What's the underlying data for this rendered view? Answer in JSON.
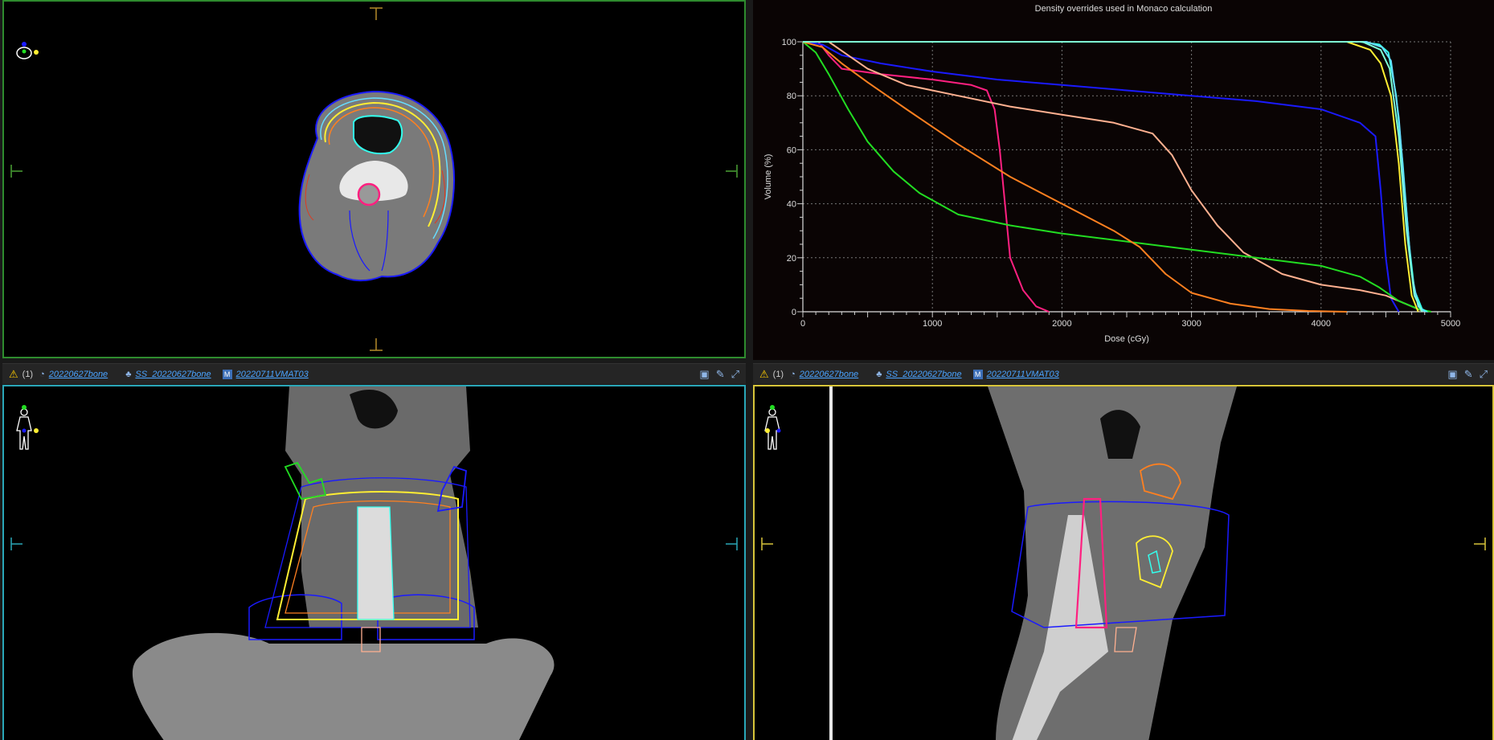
{
  "toolbar_left": {
    "warning_count": "(1)",
    "image_set": "20220627bone",
    "structure_set": "SS_20220627bone",
    "plan": "20220711VMAT03"
  },
  "toolbar_right": {
    "warning_count": "(1)",
    "image_set": "20220627bone",
    "structure_set": "SS_20220627bone",
    "plan": "20220711VMAT03"
  },
  "dvh": {
    "title": "Density overrides used in Monaco calculation"
  },
  "chart_data": {
    "type": "line",
    "title": "Density overrides used in Monaco calculation",
    "xlabel": "Dose (cGy)",
    "ylabel": "Volume (%)",
    "xlim": [
      0,
      5000
    ],
    "ylim": [
      0,
      100
    ],
    "xticks": [
      "0",
      "1000",
      "2000",
      "3000",
      "4000",
      "5000"
    ],
    "yticks": [
      "0",
      "20",
      "40",
      "60",
      "80",
      "100"
    ],
    "grid": true,
    "series": [
      {
        "color": "#ff2080",
        "x": [
          0,
          120,
          200,
          300,
          600,
          1000,
          1300,
          1420,
          1480,
          1520,
          1560,
          1600,
          1700,
          1800,
          1900
        ],
        "y": [
          100,
          100,
          95,
          90,
          88,
          86,
          84,
          82,
          75,
          60,
          40,
          20,
          8,
          2,
          0
        ]
      },
      {
        "color": "#1a1aff",
        "x": [
          0,
          150,
          300,
          600,
          1000,
          1500,
          2000,
          2500,
          3000,
          3500,
          4000,
          4300,
          4420,
          4460,
          4500,
          4540,
          4600
        ],
        "y": [
          100,
          99,
          95,
          92,
          89,
          86,
          84,
          82,
          80,
          78,
          75,
          70,
          65,
          45,
          20,
          5,
          0
        ]
      },
      {
        "color": "#ffb090",
        "x": [
          0,
          200,
          350,
          500,
          800,
          1200,
          1600,
          2000,
          2400,
          2700,
          2850,
          3000,
          3200,
          3400,
          3700,
          4000,
          4300,
          4500,
          4700,
          4800
        ],
        "y": [
          100,
          100,
          95,
          90,
          84,
          80,
          76,
          73,
          70,
          66,
          58,
          45,
          32,
          22,
          14,
          10,
          8,
          6,
          2,
          0
        ]
      },
      {
        "color": "#22dd22",
        "x": [
          0,
          100,
          200,
          350,
          500,
          700,
          900,
          1200,
          1600,
          2000,
          2500,
          3000,
          3500,
          4000,
          4300,
          4450,
          4600,
          4750,
          4850
        ],
        "y": [
          100,
          96,
          88,
          75,
          63,
          52,
          44,
          36,
          32,
          29,
          26,
          23,
          20,
          17,
          13,
          9,
          4,
          1,
          0
        ]
      },
      {
        "color": "#ff8020",
        "x": [
          0,
          150,
          300,
          500,
          800,
          1200,
          1600,
          2000,
          2400,
          2600,
          2800,
          3000,
          3300,
          3600,
          3900,
          4200
        ],
        "y": [
          100,
          98,
          92,
          85,
          75,
          62,
          50,
          40,
          30,
          24,
          14,
          7,
          3,
          1,
          0.3,
          0
        ]
      },
      {
        "color": "#ffee33",
        "x": [
          0,
          4200,
          4380,
          4460,
          4540,
          4600,
          4650,
          4700,
          4750
        ],
        "y": [
          100,
          100,
          97,
          92,
          80,
          55,
          25,
          6,
          0
        ]
      },
      {
        "color": "#33ffee",
        "x": [
          0,
          4300,
          4450,
          4520,
          4580,
          4630,
          4680,
          4720,
          4780,
          4820
        ],
        "y": [
          100,
          100,
          99,
          96,
          80,
          55,
          25,
          8,
          1,
          0
        ]
      },
      {
        "color": "#66ddff",
        "x": [
          0,
          4350,
          4470,
          4540,
          4600,
          4650,
          4700,
          4750,
          4800
        ],
        "y": [
          100,
          100,
          98,
          93,
          72,
          42,
          14,
          2,
          0
        ]
      },
      {
        "color": "#7fffd4",
        "x": [
          0,
          4320,
          4460,
          4530,
          4600,
          4660,
          4720,
          4780
        ],
        "y": [
          100,
          100,
          97,
          90,
          65,
          30,
          6,
          0
        ]
      }
    ]
  }
}
